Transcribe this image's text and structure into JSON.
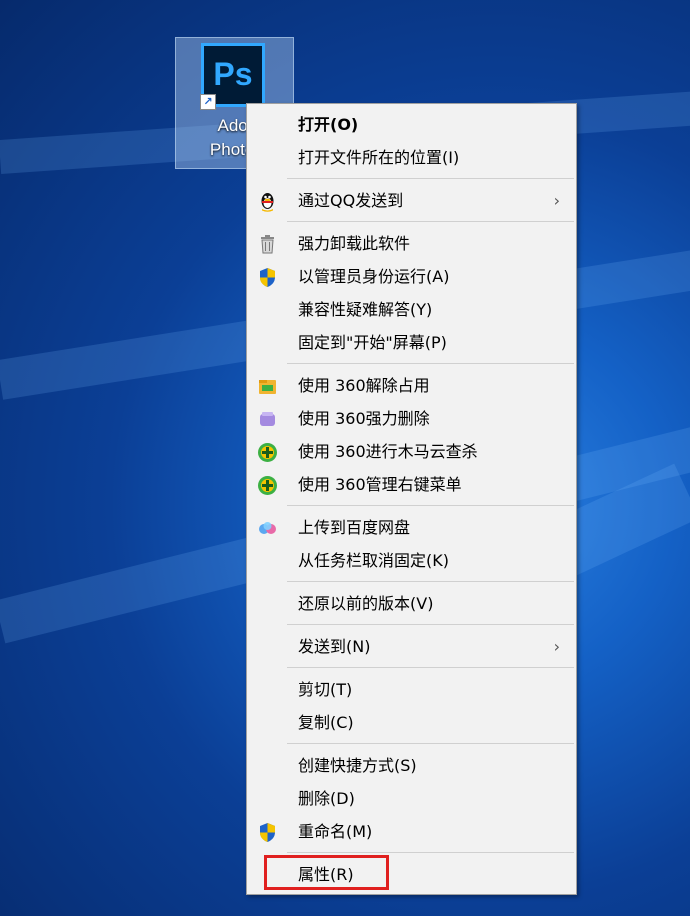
{
  "desktop_icon": {
    "logo_text": "Ps",
    "label_line1": "Adol",
    "label_line2": "Photo:"
  },
  "menu": {
    "items": [
      {
        "label": "打开(O)",
        "icon": "none"
      },
      {
        "label": "打开文件所在的位置(I)",
        "icon": "none"
      },
      {
        "label": "通过QQ发送到",
        "icon": "qq-penguin-icon",
        "submenu": "›"
      },
      {
        "label": "强力卸载此软件",
        "icon": "trash-bin-icon"
      },
      {
        "label": "以管理员身份运行(A)",
        "icon": "uac-shield-icon"
      },
      {
        "label": "兼容性疑难解答(Y)",
        "icon": "none"
      },
      {
        "label": "固定到\"开始\"屏幕(P)",
        "icon": "none"
      },
      {
        "label": "使用 360解除占用",
        "icon": "360-unlock-folder-icon"
      },
      {
        "label": "使用 360强力删除",
        "icon": "360-shred-icon"
      },
      {
        "label": "使用 360进行木马云查杀",
        "icon": "360-scan-icon"
      },
      {
        "label": "使用 360管理右键菜单",
        "icon": "360-menu-manager-icon"
      },
      {
        "label": "上传到百度网盘",
        "icon": "baidu-netdisk-icon"
      },
      {
        "label": "从任务栏取消固定(K)",
        "icon": "none"
      },
      {
        "label": "还原以前的版本(V)",
        "icon": "none"
      },
      {
        "label": "发送到(N)",
        "icon": "none",
        "submenu": "›"
      },
      {
        "label": "剪切(T)",
        "icon": "none"
      },
      {
        "label": "复制(C)",
        "icon": "none"
      },
      {
        "label": "创建快捷方式(S)",
        "icon": "none"
      },
      {
        "label": "删除(D)",
        "icon": "none"
      },
      {
        "label": "重命名(M)",
        "icon": "uac-shield-icon"
      },
      {
        "label": "属性(R)",
        "icon": "none"
      }
    ]
  },
  "colors": {
    "highlight_box": "#e0201f",
    "menu_bg": "#f2f2f2",
    "desktop": "#0b3f96"
  }
}
